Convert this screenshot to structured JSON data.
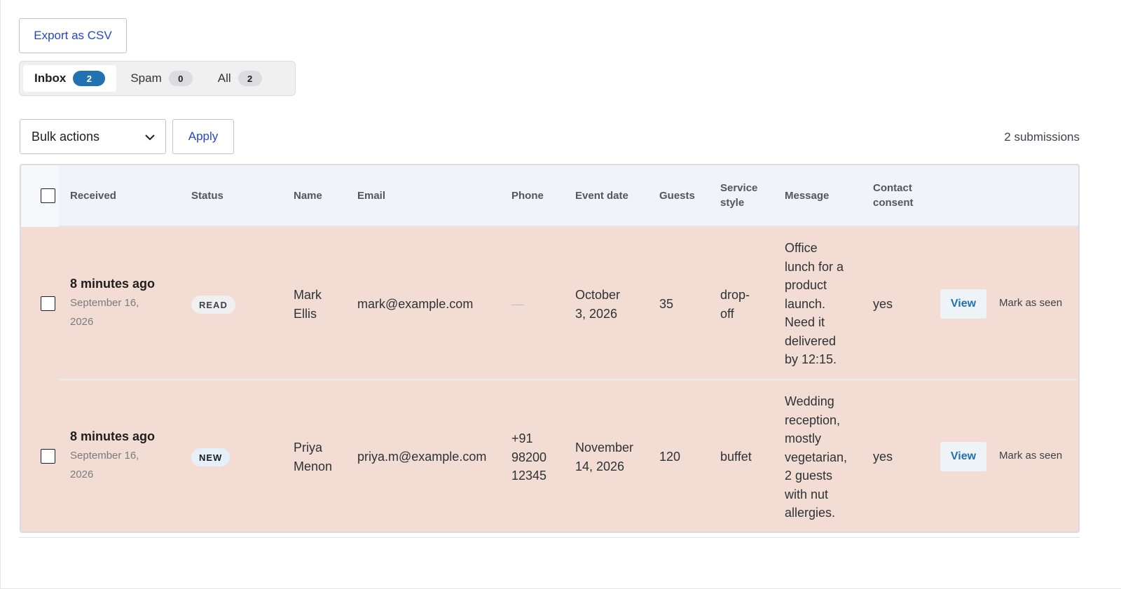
{
  "toolbar": {
    "export_label": "Export as CSV",
    "bulk_select_value": "Bulk actions",
    "apply_label": "Apply",
    "submission_count": "2 submissions"
  },
  "tabs": [
    {
      "label": "Inbox",
      "count": "2",
      "active": true
    },
    {
      "label": "Spam",
      "count": "0",
      "active": false
    },
    {
      "label": "All",
      "count": "2",
      "active": false
    }
  ],
  "table": {
    "headers": {
      "received": "Received",
      "status": "Status",
      "name": "Name",
      "email": "Email",
      "phone": "Phone",
      "event_date": "Event date",
      "guests": "Guests",
      "service_style_1": "Service",
      "service_style_2": "style",
      "message": "Message",
      "consent_1": "Contact",
      "consent_2": "consent"
    },
    "rows": [
      {
        "received_ago": "8 minutes ago",
        "received_date_1": "September 16,",
        "received_date_2": "2026",
        "status": "READ",
        "name_1": "Mark",
        "name_2": "Ellis",
        "email": "mark@example.com",
        "phone": "—",
        "event_date_1": "October",
        "event_date_2": "3, 2026",
        "guests": "35",
        "service_1": "drop-",
        "service_2": "off",
        "message_lines": [
          "Office",
          "lunch for a",
          "product",
          "launch.",
          "Need it",
          "delivered",
          "by 12:15."
        ],
        "consent": "yes",
        "view_label": "View",
        "mark_label": "Mark as seen"
      },
      {
        "received_ago": "8 minutes ago",
        "received_date_1": "September 16,",
        "received_date_2": "2026",
        "status": "NEW",
        "name_1": "Priya",
        "name_2": "Menon",
        "email": "priya.m@example.com",
        "phone_1": "+91",
        "phone_2": "98200",
        "phone_3": "12345",
        "event_date_1": "November",
        "event_date_2": "14, 2026",
        "guests": "120",
        "service_1": "buffet",
        "message_lines": [
          "Wedding",
          "reception,",
          "mostly",
          "vegetarian,",
          "2 guests",
          "with nut",
          "allergies."
        ],
        "consent": "yes",
        "view_label": "View",
        "mark_label": "Mark as seen"
      }
    ]
  },
  "colors": {
    "accent": "#2271b1",
    "link": "#2745c4",
    "row_highlight": "#f3dcd3",
    "header_bg": "#f0f3f8"
  },
  "icons": {
    "bulk_chevron": "chevron-down-icon"
  }
}
